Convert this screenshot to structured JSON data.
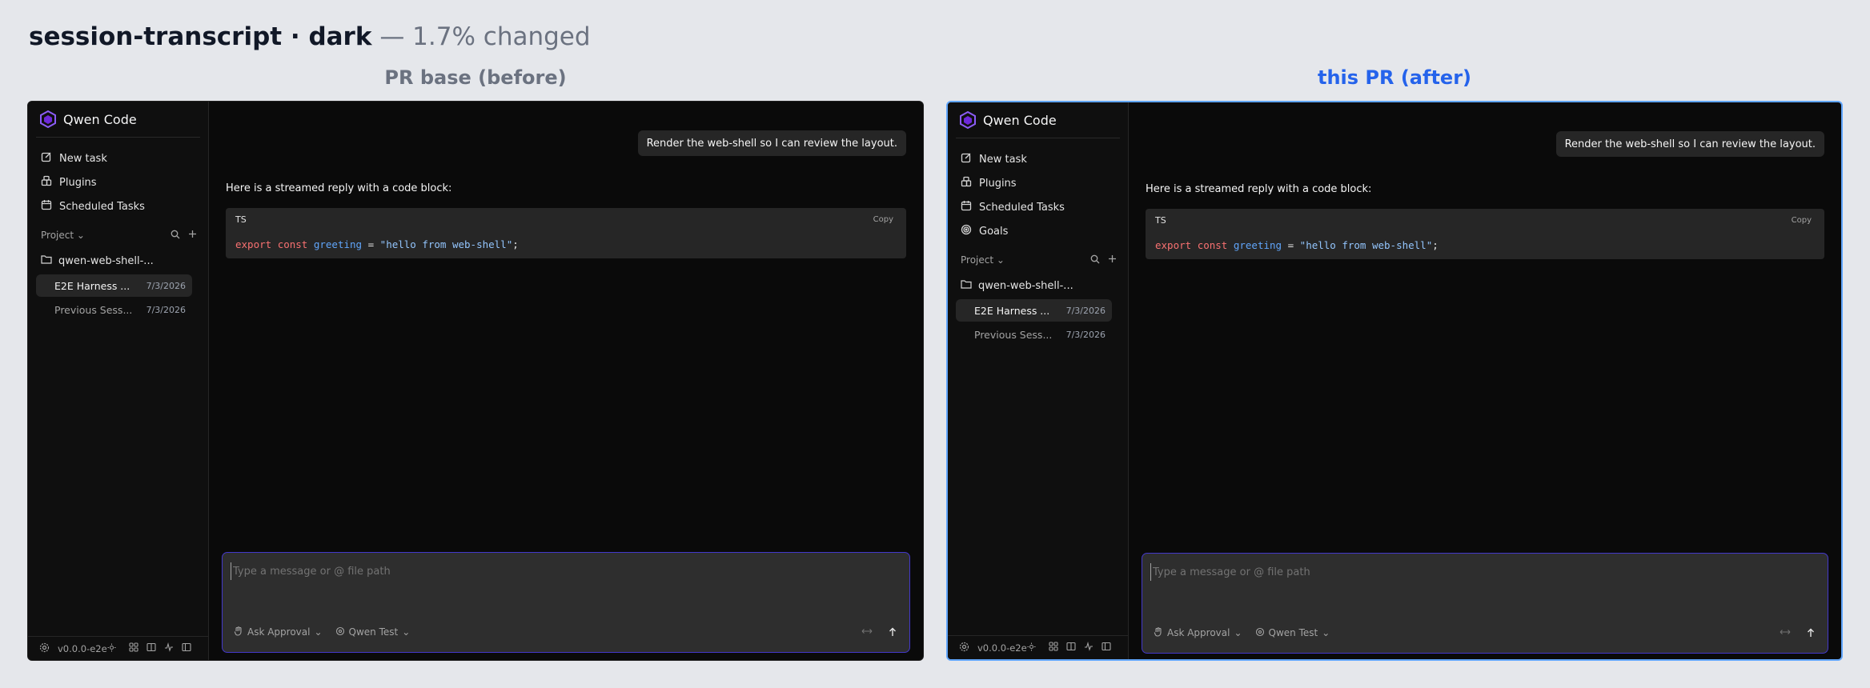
{
  "page": {
    "title_main": "session-transcript · dark",
    "title_suffix": "— 1.7% changed"
  },
  "columns": {
    "before_title": "PR base (before)",
    "after_title": "this PR (after)"
  },
  "app": {
    "name": "Qwen Code",
    "nav_before": [
      "New task",
      "Plugins",
      "Scheduled Tasks"
    ],
    "nav_after": [
      "New task",
      "Plugins",
      "Scheduled Tasks",
      "Goals"
    ],
    "project_label": "Project",
    "folder": "qwen-web-shell-...",
    "sessions": [
      {
        "title": "E2E Harness ...",
        "date": "7/3/2026"
      },
      {
        "title": "Previous Sess...",
        "date": "7/3/2026"
      }
    ],
    "version": "v0.0.0-e2e"
  },
  "chat": {
    "user_message": "Render the web-shell so I can review the layout.",
    "reply": "Here is a streamed reply with a code block:",
    "code_lang": "TS",
    "copy_label": "Copy",
    "code": {
      "kw1": "export",
      "kw2": "const",
      "name": "greeting",
      "op": "=",
      "str": "\"hello from web-shell\"",
      "end": ";"
    }
  },
  "composer": {
    "placeholder": "Type a message or @ file path",
    "approval": "Ask Approval",
    "model": "Qwen Test"
  },
  "colors": {
    "accent_after": "#2563eb",
    "panel_bg": "#0a0a0a",
    "composer_border": "#4338ca"
  }
}
